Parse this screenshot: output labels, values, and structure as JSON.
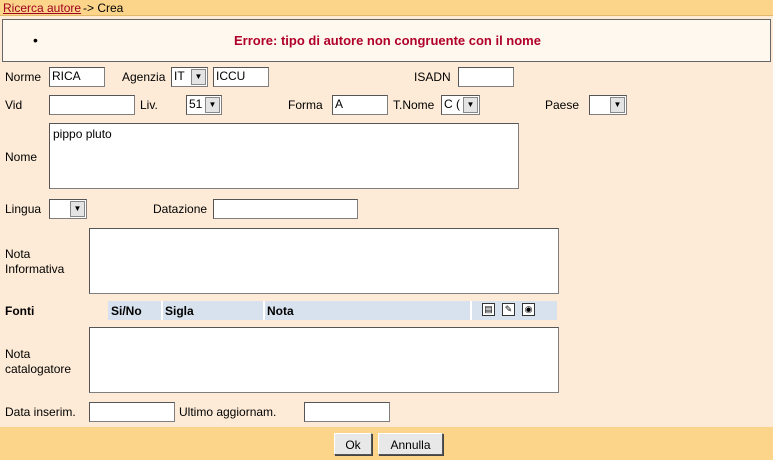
{
  "breadcrumb": {
    "link": "Ricerca autore",
    "current": "-> Crea"
  },
  "error": {
    "message": "Errore: tipo di autore non congruente con il nome"
  },
  "form": {
    "nome_label": "Norme",
    "nome_value": "RICA",
    "agenzia_label": "Agenzia",
    "agenzia_country": "IT",
    "agenzia_code": "ICCU",
    "isadn_label": "ISADN",
    "isadn_value": "",
    "vid_label": "Vid",
    "vid_value": "",
    "liv_label": "Liv.",
    "liv_value": "51",
    "forma_label": "Forma",
    "forma_value": "A",
    "tnome_label": "T.Nome",
    "tnome_value": "C (",
    "paese_label": "Paese",
    "paese_value": "",
    "nome2_label": "Nome",
    "nome2_value": "pippo pluto",
    "lingua_label": "Lingua",
    "lingua_value": "",
    "datazione_label": "Datazione",
    "datazione_value": "",
    "nota_inf_label_1": "Nota",
    "nota_inf_label_2": "Informativa",
    "nota_inf_value": "",
    "nota_cat_label_1": "Nota",
    "nota_cat_label_2": "catalogatore",
    "nota_cat_value": "",
    "data_ins_label": "Data inserim.",
    "data_ins_value": "",
    "ultimo_label": "Ultimo aggiornam.",
    "ultimo_value": ""
  },
  "fonti": {
    "label": "Fonti",
    "columns": [
      "Si/No",
      "Sigla",
      "Nota"
    ],
    "icons": [
      "add-row-icon",
      "edit-row-icon",
      "search-binoculars-icon"
    ]
  },
  "buttons": {
    "ok": "Ok",
    "annulla": "Annulla"
  }
}
